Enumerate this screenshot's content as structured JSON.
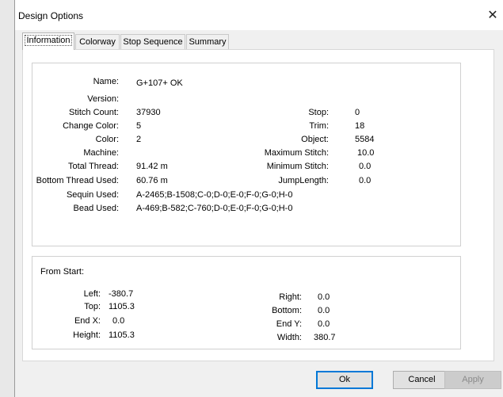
{
  "window": {
    "title": "Design Options",
    "close": "✕"
  },
  "tabs": [
    "Information",
    "Colorway",
    "Stop Sequence",
    "Summary"
  ],
  "info": {
    "name_label": "Name:",
    "name": "G+107+ OK",
    "version_label": "Version:",
    "version": "",
    "stitch_count_label": "Stitch Count:",
    "stitch_count": "37930",
    "change_color_label": "Change Color:",
    "change_color": "5",
    "color_label": "Color:",
    "color": "2",
    "machine_label": "Machine:",
    "machine": "",
    "total_thread_label": "Total Thread:",
    "total_thread": "91.42 m",
    "bottom_thread_label": "Bottom Thread Used:",
    "bottom_thread": "60.76 m",
    "sequin_label": "Sequin Used:",
    "sequin": "A-2465;B-1508;C-0;D-0;E-0;F-0;G-0;H-0",
    "bead_label": "Bead Used:",
    "bead": "A-469;B-582;C-760;D-0;E-0;F-0;G-0;H-0",
    "stop_label": "Stop:",
    "stop": "0",
    "trim_label": "Trim:",
    "trim": "18",
    "object_label": "Object:",
    "object": "5584",
    "max_stitch_label": "Maximum Stitch:",
    "max_stitch": "10.0",
    "min_stitch_label": "Minimum Stitch:",
    "min_stitch": "0.0",
    "jump_length_label": "JumpLength:",
    "jump_length": "0.0"
  },
  "from_start": {
    "heading": "From Start:",
    "left_label": "Left:",
    "left": "-380.7",
    "top_label": "Top:",
    "top": "1105.3",
    "end_x_label": "End X:",
    "end_x": "0.0",
    "height_label": "Height:",
    "height": "1105.3",
    "right_label": "Right:",
    "right": "0.0",
    "bottom_label": "Bottom:",
    "bottom": "0.0",
    "end_y_label": "End Y:",
    "end_y": "0.0",
    "width_label": "Width:",
    "width": "380.7"
  },
  "buttons": {
    "ok": "Ok",
    "cancel": "Cancel",
    "apply": "Apply"
  }
}
